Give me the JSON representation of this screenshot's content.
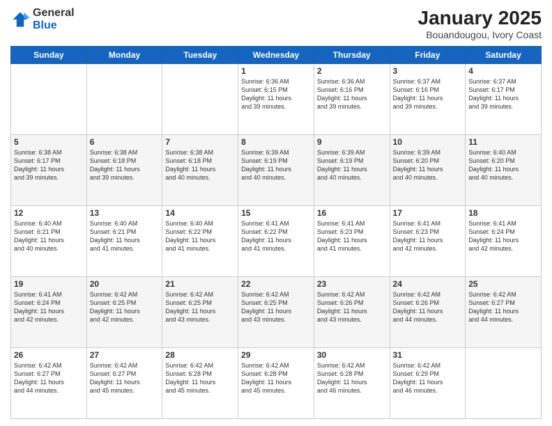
{
  "header": {
    "logo_general": "General",
    "logo_blue": "Blue",
    "title": "January 2025",
    "location": "Bouandougou, Ivory Coast"
  },
  "weekdays": [
    "Sunday",
    "Monday",
    "Tuesday",
    "Wednesday",
    "Thursday",
    "Friday",
    "Saturday"
  ],
  "weeks": [
    [
      {
        "day": "",
        "info": ""
      },
      {
        "day": "",
        "info": ""
      },
      {
        "day": "",
        "info": ""
      },
      {
        "day": "1",
        "info": "Sunrise: 6:36 AM\nSunset: 6:15 PM\nDaylight: 11 hours\nand 39 minutes."
      },
      {
        "day": "2",
        "info": "Sunrise: 6:36 AM\nSunset: 6:16 PM\nDaylight: 11 hours\nand 39 minutes."
      },
      {
        "day": "3",
        "info": "Sunrise: 6:37 AM\nSunset: 6:16 PM\nDaylight: 11 hours\nand 39 minutes."
      },
      {
        "day": "4",
        "info": "Sunrise: 6:37 AM\nSunset: 6:17 PM\nDaylight: 11 hours\nand 39 minutes."
      }
    ],
    [
      {
        "day": "5",
        "info": "Sunrise: 6:38 AM\nSunset: 6:17 PM\nDaylight: 11 hours\nand 39 minutes."
      },
      {
        "day": "6",
        "info": "Sunrise: 6:38 AM\nSunset: 6:18 PM\nDaylight: 11 hours\nand 39 minutes."
      },
      {
        "day": "7",
        "info": "Sunrise: 6:38 AM\nSunset: 6:18 PM\nDaylight: 11 hours\nand 40 minutes."
      },
      {
        "day": "8",
        "info": "Sunrise: 6:39 AM\nSunset: 6:19 PM\nDaylight: 11 hours\nand 40 minutes."
      },
      {
        "day": "9",
        "info": "Sunrise: 6:39 AM\nSunset: 6:19 PM\nDaylight: 11 hours\nand 40 minutes."
      },
      {
        "day": "10",
        "info": "Sunrise: 6:39 AM\nSunset: 6:20 PM\nDaylight: 11 hours\nand 40 minutes."
      },
      {
        "day": "11",
        "info": "Sunrise: 6:40 AM\nSunset: 6:20 PM\nDaylight: 11 hours\nand 40 minutes."
      }
    ],
    [
      {
        "day": "12",
        "info": "Sunrise: 6:40 AM\nSunset: 6:21 PM\nDaylight: 11 hours\nand 40 minutes."
      },
      {
        "day": "13",
        "info": "Sunrise: 6:40 AM\nSunset: 6:21 PM\nDaylight: 11 hours\nand 41 minutes."
      },
      {
        "day": "14",
        "info": "Sunrise: 6:40 AM\nSunset: 6:22 PM\nDaylight: 11 hours\nand 41 minutes."
      },
      {
        "day": "15",
        "info": "Sunrise: 6:41 AM\nSunset: 6:22 PM\nDaylight: 11 hours\nand 41 minutes."
      },
      {
        "day": "16",
        "info": "Sunrise: 6:41 AM\nSunset: 6:23 PM\nDaylight: 11 hours\nand 41 minutes."
      },
      {
        "day": "17",
        "info": "Sunrise: 6:41 AM\nSunset: 6:23 PM\nDaylight: 11 hours\nand 42 minutes."
      },
      {
        "day": "18",
        "info": "Sunrise: 6:41 AM\nSunset: 6:24 PM\nDaylight: 11 hours\nand 42 minutes."
      }
    ],
    [
      {
        "day": "19",
        "info": "Sunrise: 6:41 AM\nSunset: 6:24 PM\nDaylight: 11 hours\nand 42 minutes."
      },
      {
        "day": "20",
        "info": "Sunrise: 6:42 AM\nSunset: 6:25 PM\nDaylight: 11 hours\nand 42 minutes."
      },
      {
        "day": "21",
        "info": "Sunrise: 6:42 AM\nSunset: 6:25 PM\nDaylight: 11 hours\nand 43 minutes."
      },
      {
        "day": "22",
        "info": "Sunrise: 6:42 AM\nSunset: 6:25 PM\nDaylight: 11 hours\nand 43 minutes."
      },
      {
        "day": "23",
        "info": "Sunrise: 6:42 AM\nSunset: 6:26 PM\nDaylight: 11 hours\nand 43 minutes."
      },
      {
        "day": "24",
        "info": "Sunrise: 6:42 AM\nSunset: 6:26 PM\nDaylight: 11 hours\nand 44 minutes."
      },
      {
        "day": "25",
        "info": "Sunrise: 6:42 AM\nSunset: 6:27 PM\nDaylight: 11 hours\nand 44 minutes."
      }
    ],
    [
      {
        "day": "26",
        "info": "Sunrise: 6:42 AM\nSunset: 6:27 PM\nDaylight: 11 hours\nand 44 minutes."
      },
      {
        "day": "27",
        "info": "Sunrise: 6:42 AM\nSunset: 6:27 PM\nDaylight: 11 hours\nand 45 minutes."
      },
      {
        "day": "28",
        "info": "Sunrise: 6:42 AM\nSunset: 6:28 PM\nDaylight: 11 hours\nand 45 minutes."
      },
      {
        "day": "29",
        "info": "Sunrise: 6:42 AM\nSunset: 6:28 PM\nDaylight: 11 hours\nand 45 minutes."
      },
      {
        "day": "30",
        "info": "Sunrise: 6:42 AM\nSunset: 6:28 PM\nDaylight: 11 hours\nand 46 minutes."
      },
      {
        "day": "31",
        "info": "Sunrise: 6:42 AM\nSunset: 6:29 PM\nDaylight: 11 hours\nand 46 minutes."
      },
      {
        "day": "",
        "info": ""
      }
    ]
  ]
}
